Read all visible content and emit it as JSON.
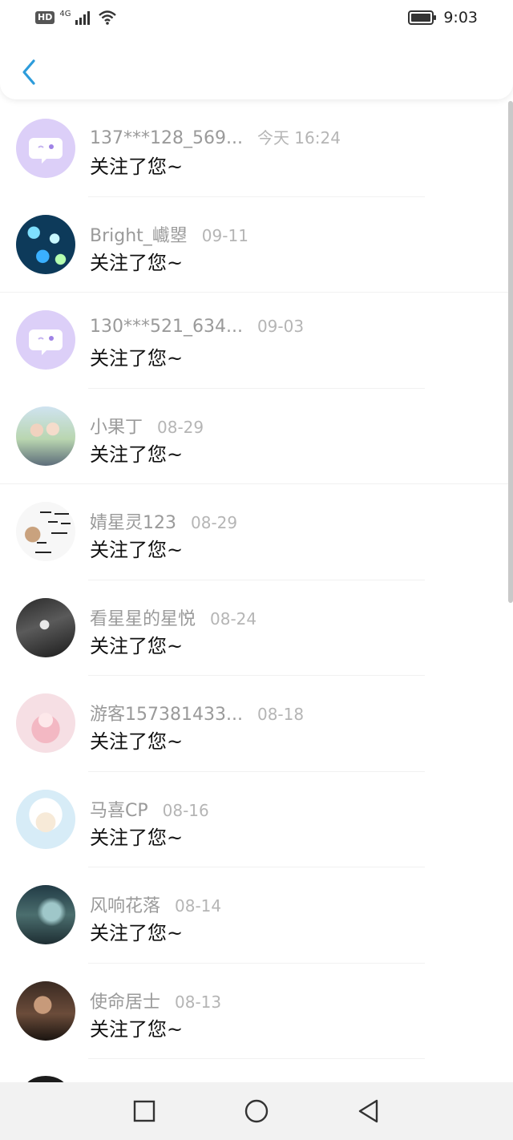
{
  "status_bar": {
    "hd_label": "HD",
    "network_label": "4G",
    "time": "9:03",
    "icons": [
      "signal-icon",
      "wifi-icon",
      "battery-icon"
    ]
  },
  "header": {
    "back_icon": "chevron-left-icon",
    "accent_color": "#2d9cdb"
  },
  "notifications": [
    {
      "name": "137***128_569...",
      "date": "今天 16:24",
      "message": "关注了您~",
      "avatar": "default-avatar"
    },
    {
      "name": "Bright_巇曌",
      "date": "09-11",
      "message": "关注了您~",
      "avatar": "photo-avatar"
    },
    {
      "name": "130***521_634...",
      "date": "09-03",
      "message": "关注了您~",
      "avatar": "default-avatar"
    },
    {
      "name": "小果丁",
      "date": "08-29",
      "message": "关注了您~",
      "avatar": "photo-avatar"
    },
    {
      "name": "婧星灵123",
      "date": "08-29",
      "message": "关注了您~",
      "avatar": "photo-avatar"
    },
    {
      "name": "看星星的星悦",
      "date": "08-24",
      "message": "关注了您~",
      "avatar": "photo-avatar"
    },
    {
      "name": "游客157381433...",
      "date": "08-18",
      "message": "关注了您~",
      "avatar": "photo-avatar"
    },
    {
      "name": "马喜CP",
      "date": "08-16",
      "message": "关注了您~",
      "avatar": "photo-avatar"
    },
    {
      "name": "风响花落",
      "date": "08-14",
      "message": "关注了您~",
      "avatar": "photo-avatar"
    },
    {
      "name": "使命居士",
      "date": "08-13",
      "message": "关注了您~",
      "avatar": "photo-avatar"
    }
  ],
  "nav_bar": {
    "icons": [
      "recents-square-icon",
      "home-circle-icon",
      "back-triangle-icon"
    ]
  }
}
